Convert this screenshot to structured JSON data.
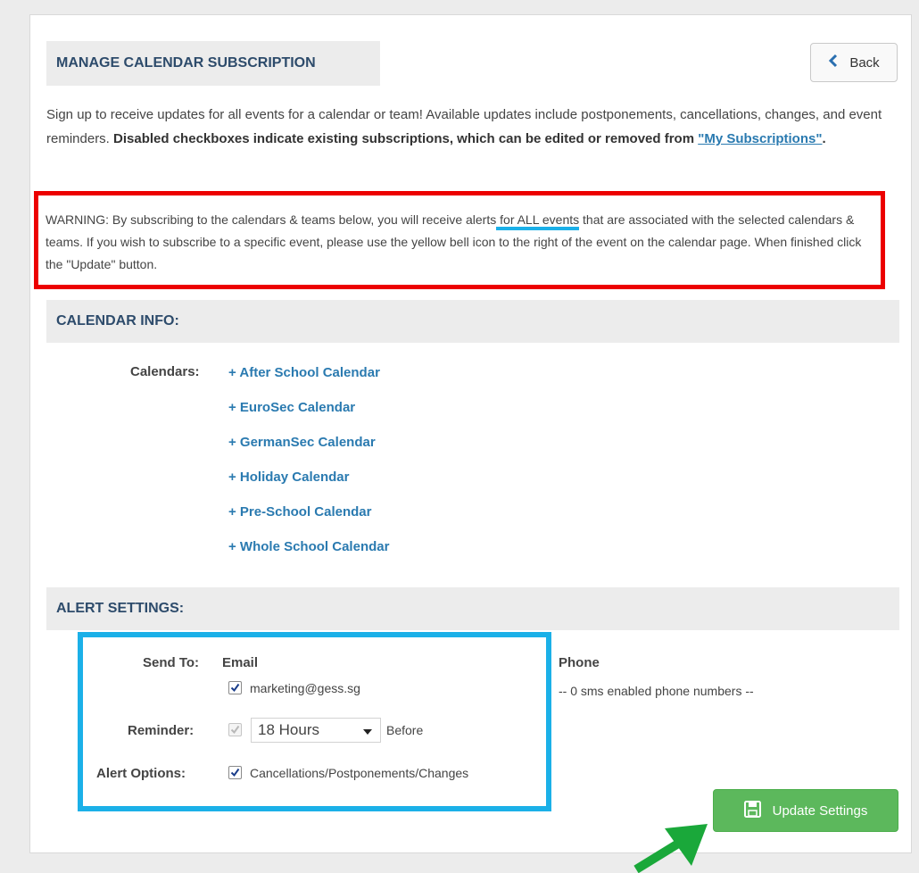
{
  "header": {
    "title": "MANAGE CALENDAR SUBSCRIPTION",
    "back_label": "Back"
  },
  "intro": {
    "text1": "Sign up to receive updates for all events for a calendar or team! Available updates include postponements, cancellations, changes, and event reminders.",
    "bold_text": "Disabled checkboxes indicate existing subscriptions, which can be edited or removed from",
    "link_text": "\"My Subscriptions\"",
    "period": "."
  },
  "warning": {
    "part1": "WARNING: By subscribing to the calendars & teams below, you will receive alerts",
    "highlight": " for ALL events",
    "part2": " that are associated with the selected calendars & teams. If you wish to subscribe to a specific event, please use the yellow bell icon to the right of the event on the calendar page. When finished click the \"Update\" button."
  },
  "calendar_info": {
    "heading": "CALENDAR INFO:",
    "label": "Calendars:",
    "items": [
      "+ After School Calendar",
      "+ EuroSec Calendar",
      "+ GermanSec Calendar",
      "+ Holiday Calendar",
      "+ Pre-School Calendar",
      "+ Whole School Calendar"
    ]
  },
  "alert_settings": {
    "heading": "ALERT SETTINGS:",
    "send_to_label": "Send To:",
    "email_label": "Email",
    "email_value": "marketing@gess.sg",
    "email_checked": true,
    "phone_label": "Phone",
    "phone_value": "-- 0 sms enabled phone numbers --",
    "reminder_label": "Reminder:",
    "reminder_checked": true,
    "reminder_disabled": true,
    "reminder_value": "18 Hours",
    "reminder_suffix": "Before",
    "alert_options_label": "Alert Options:",
    "alert_option_text": "Cancellations/Postponements/Changes",
    "alert_option_checked": true
  },
  "update_button": {
    "label": "Update Settings",
    "icon": "save-icon",
    "color": "#5cb85c"
  },
  "annotations": {
    "warning_box_color": "#ec0000",
    "settings_box_color": "#1bb0e8",
    "arrow_color": "#1aa83a"
  }
}
